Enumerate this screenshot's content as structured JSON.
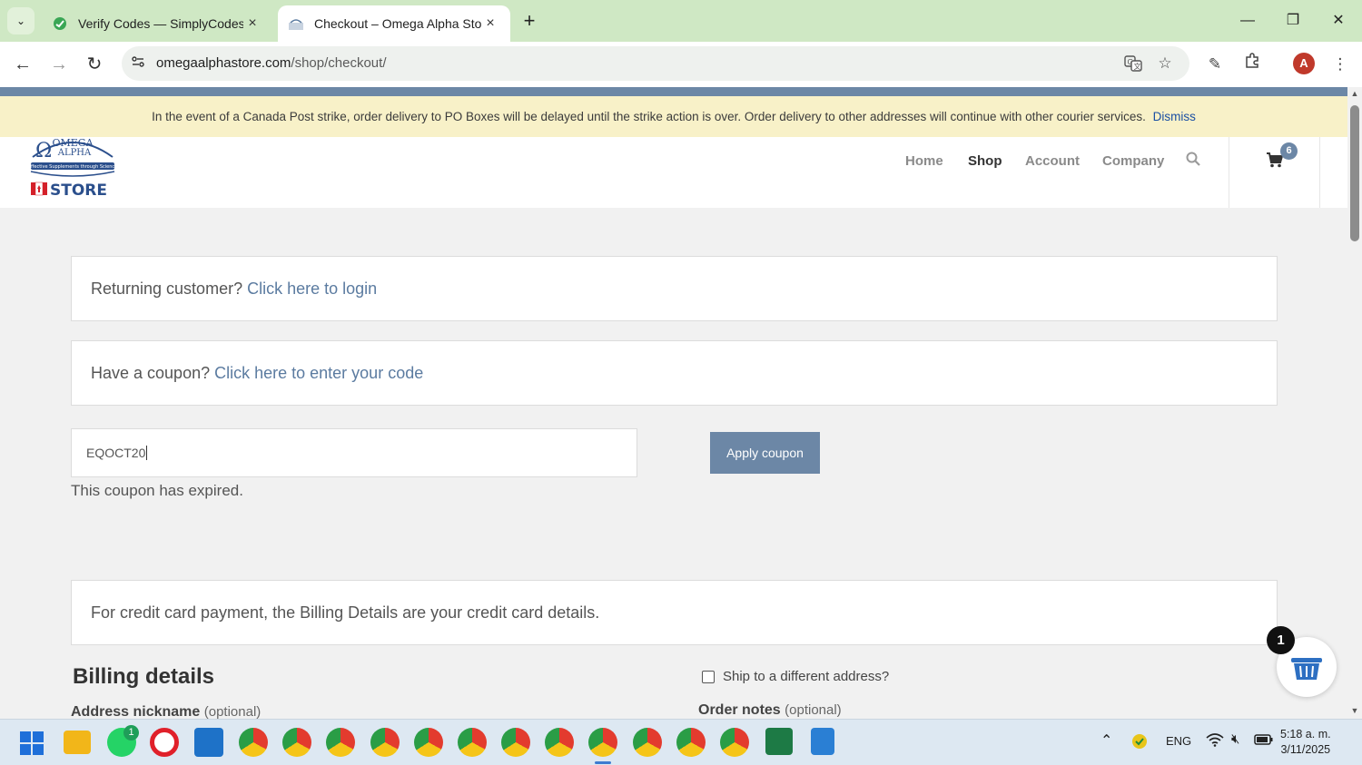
{
  "browser": {
    "tabs": [
      {
        "title": "Verify Codes — SimplyCodes",
        "active": false
      },
      {
        "title": "Checkout – Omega Alpha Store",
        "active": true
      }
    ],
    "url_host": "omegaalphastore.com",
    "url_path": "/shop/checkout/",
    "profile_initial": "A"
  },
  "notice": {
    "text": "In the event of a Canada Post strike, order delivery to PO Boxes will be delayed until the strike action is over. Order delivery to other addresses will continue with other courier services.",
    "dismiss": "Dismiss"
  },
  "header": {
    "logo_line1": "OMEGA",
    "logo_line2": "ALPHA",
    "logo_tagline": "Effective Supplements through Science",
    "logo_store": "STORE",
    "nav": [
      "Home",
      "Shop",
      "Account",
      "Company"
    ],
    "active_nav": "Shop",
    "cart_count": "6"
  },
  "checkout": {
    "returning_prefix": "Returning customer? ",
    "returning_link": "Click here to login",
    "coupon_prefix": "Have a coupon? ",
    "coupon_link": "Click here to enter your code",
    "coupon_value": "EQOCT20",
    "apply_label": "Apply coupon",
    "coupon_message": "This coupon has expired.",
    "credit_card_note": "For credit card payment, the Billing Details are your credit card details.",
    "billing_title": "Billing details",
    "ship_label": "Ship to a different address?",
    "address_label": "Address nickname",
    "order_notes_label": "Order notes",
    "optional": "(optional)",
    "basket_count": "1"
  },
  "taskbar": {
    "language": "ENG",
    "time": "5:18 a. m.",
    "date": "3/11/2025",
    "whatsapp_badge": "1"
  },
  "colors": {
    "accent": "#6c87a6",
    "link": "#5b7ba0",
    "notice_bg": "#f8f1c8",
    "tab_strip": "#cfe8c4"
  }
}
